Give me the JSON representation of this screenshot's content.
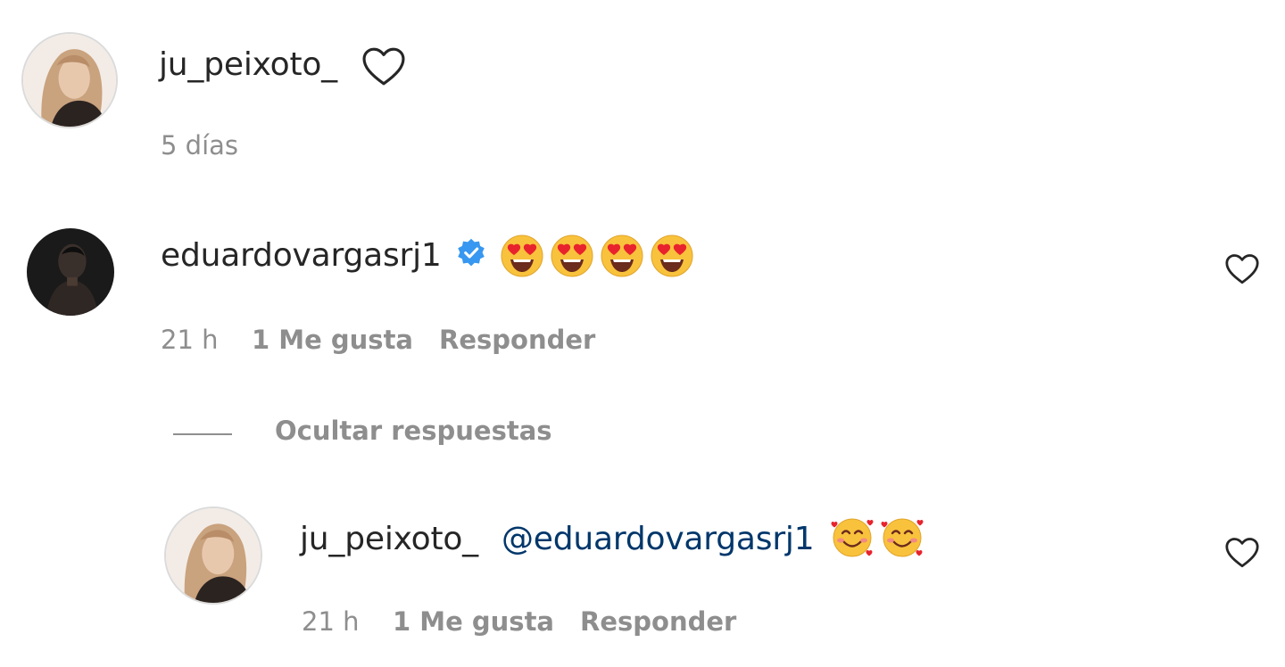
{
  "comment": {
    "username": "ju_peixoto_",
    "age": "5 días"
  },
  "reply_parent": {
    "username": "eduardovargasrj1",
    "verified": true,
    "text_emojis": [
      "heart-eyes-emoji",
      "heart-eyes-emoji",
      "heart-eyes-emoji",
      "heart-eyes-emoji"
    ],
    "time": "21 h",
    "likes": "1 Me gusta",
    "reply_label": "Responder"
  },
  "toggle_replies_label": "Ocultar respuestas",
  "reply": {
    "username": "ju_peixoto_",
    "mention": "@eduardovargasrj1",
    "text_emojis": [
      "smiling-face-with-hearts-emoji",
      "smiling-face-with-hearts-emoji"
    ],
    "time": "21 h",
    "likes": "1 Me gusta",
    "reply_label": "Responder"
  },
  "colors": {
    "text_primary": "#262626",
    "text_secondary": "#8e8e8e",
    "mention": "#00376b",
    "verified_badge": "#3897f0"
  }
}
